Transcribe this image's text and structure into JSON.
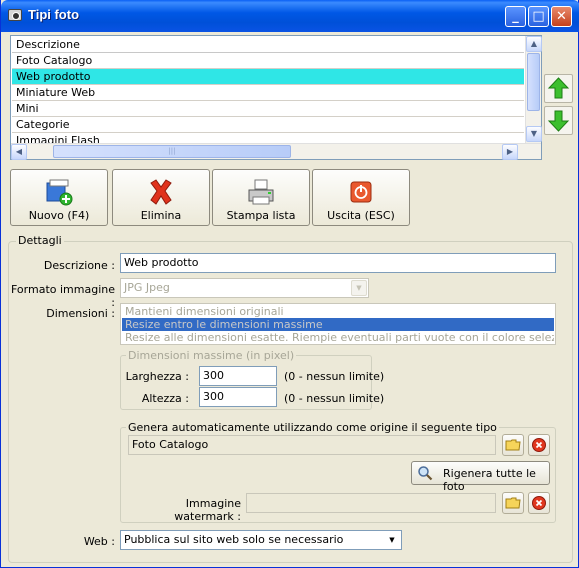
{
  "window": {
    "title": "Tipi foto",
    "minimize_glyph": "_",
    "maximize_glyph": "□",
    "close_glyph": "✕"
  },
  "list": {
    "column_header": "Descrizione",
    "items": [
      "Foto Catalogo",
      "Web prodotto",
      "Miniature Web",
      "Mini",
      "Categorie",
      "Immagini Flash"
    ],
    "selected_item": "Web prodotto",
    "scrollbar_thumb_label": "|||"
  },
  "side_buttons": {
    "move_up_icon": "arrow-up-icon",
    "move_down_icon": "arrow-down-icon"
  },
  "toolbar": {
    "new_label": "Nuovo (F4)",
    "delete_label": "Elimina",
    "print_label": "Stampa lista",
    "exit_label": "Uscita (ESC)"
  },
  "details": {
    "group_title": "Dettagli",
    "description_label": "Descrizione :",
    "description_value": "Web prodotto",
    "format_label": "Formato immagine :",
    "format_value": "JPG Jpeg",
    "dimensions_label": "Dimensioni :",
    "dimension_options": [
      "Mantieni dimensioni originali",
      "Resize entro le dimensioni massime",
      "Resize alle dimensioni esatte. Riempie eventuali parti vuote con il colore selezionato."
    ],
    "selected_dimension": "Resize entro le dimensioni massime",
    "max_dimensions": {
      "group_title": "Dimensioni massime (in pixel)",
      "width_label": "Larghezza :",
      "width_value": "300",
      "width_hint": "(0 - nessun limite)",
      "height_label": "Altezza :",
      "height_value": "300",
      "height_hint": "(0 - nessun limite)"
    },
    "auto_generate": {
      "group_title": "Genera automaticamente utilizzando come origine il seguente tipo",
      "source_value": "Foto Catalogo",
      "regenerate_label": "Rigenera tutte le foto",
      "watermark_label": "Immagine watermark :",
      "watermark_value": ""
    },
    "web_label": "Web :",
    "web_value": "Pubblica sul sito web solo se necessario"
  },
  "colors": {
    "titlebar": "#0058e6",
    "selected_row": "#2fe6e6",
    "list_selection": "#316ac5",
    "window_bg": "#ece9d8"
  }
}
